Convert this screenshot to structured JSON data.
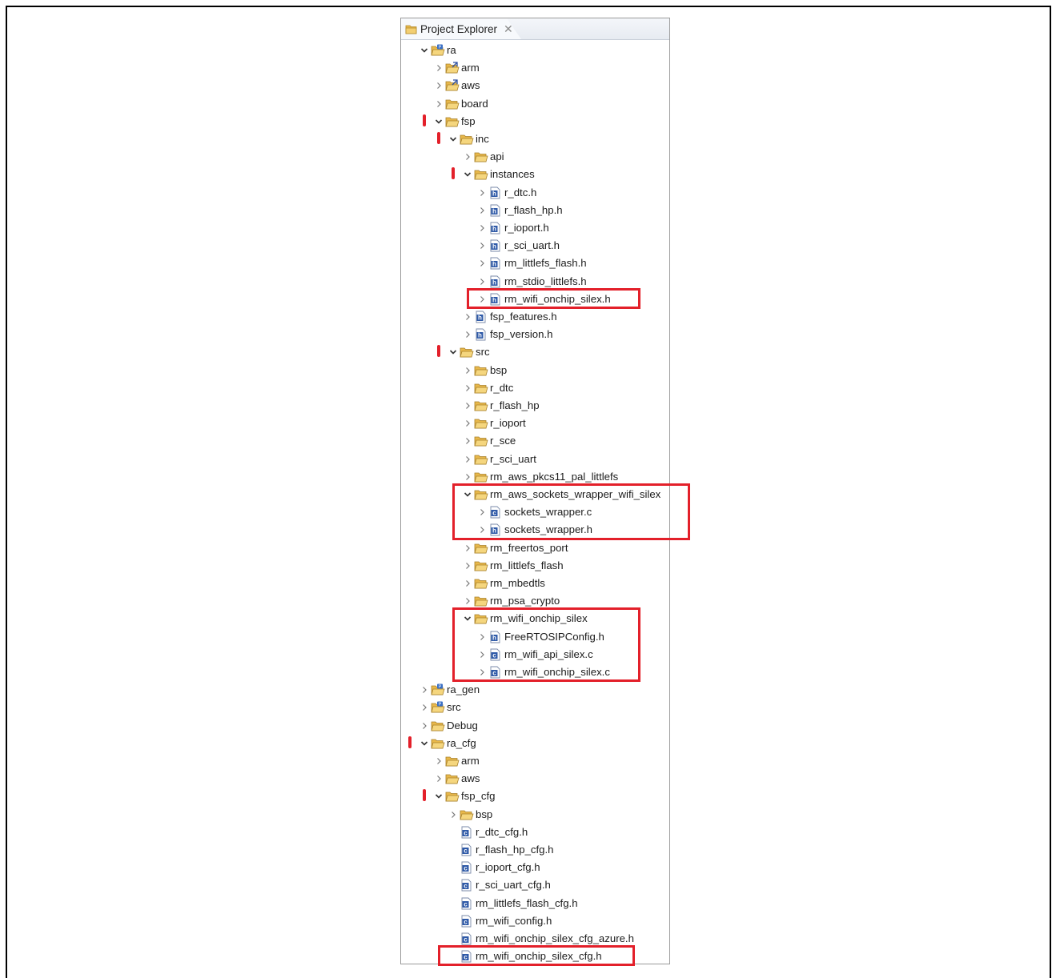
{
  "panel": {
    "tab_label": "Project Explorer",
    "tab_icon": "project-explorer-icon",
    "close_glyph": "✕"
  },
  "tree": [
    {
      "label": "ra",
      "icon": "project-folder-icon",
      "depth": 0,
      "expander": "expanded",
      "marker": false
    },
    {
      "label": "arm",
      "icon": "linked-folder-icon",
      "depth": 1,
      "expander": "collapsed",
      "marker": false
    },
    {
      "label": "aws",
      "icon": "linked-folder-icon",
      "depth": 1,
      "expander": "collapsed",
      "marker": false
    },
    {
      "label": "board",
      "icon": "folder-icon",
      "depth": 1,
      "expander": "collapsed",
      "marker": false
    },
    {
      "label": "fsp",
      "icon": "folder-icon",
      "depth": 1,
      "expander": "expanded",
      "marker": true
    },
    {
      "label": "inc",
      "icon": "folder-icon",
      "depth": 2,
      "expander": "expanded",
      "marker": true
    },
    {
      "label": "api",
      "icon": "folder-icon",
      "depth": 3,
      "expander": "collapsed",
      "marker": false
    },
    {
      "label": "instances",
      "icon": "folder-icon",
      "depth": 3,
      "expander": "expanded",
      "marker": true
    },
    {
      "label": "r_dtc.h",
      "icon": "header-file-icon",
      "depth": 4,
      "expander": "collapsed",
      "marker": false
    },
    {
      "label": "r_flash_hp.h",
      "icon": "header-file-icon",
      "depth": 4,
      "expander": "collapsed",
      "marker": false
    },
    {
      "label": "r_ioport.h",
      "icon": "header-file-icon",
      "depth": 4,
      "expander": "collapsed",
      "marker": false
    },
    {
      "label": "r_sci_uart.h",
      "icon": "header-file-icon",
      "depth": 4,
      "expander": "collapsed",
      "marker": false
    },
    {
      "label": "rm_littlefs_flash.h",
      "icon": "header-file-icon",
      "depth": 4,
      "expander": "collapsed",
      "marker": false
    },
    {
      "label": "rm_stdio_littlefs.h",
      "icon": "header-file-icon",
      "depth": 4,
      "expander": "collapsed",
      "marker": false
    },
    {
      "label": "rm_wifi_onchip_silex.h",
      "icon": "header-file-icon",
      "depth": 4,
      "expander": "collapsed",
      "marker": false
    },
    {
      "label": "fsp_features.h",
      "icon": "header-file-icon",
      "depth": 3,
      "expander": "collapsed",
      "marker": false
    },
    {
      "label": "fsp_version.h",
      "icon": "header-file-icon",
      "depth": 3,
      "expander": "collapsed",
      "marker": false
    },
    {
      "label": "src",
      "icon": "folder-icon",
      "depth": 2,
      "expander": "expanded",
      "marker": true
    },
    {
      "label": "bsp",
      "icon": "folder-icon",
      "depth": 3,
      "expander": "collapsed",
      "marker": false
    },
    {
      "label": "r_dtc",
      "icon": "folder-icon",
      "depth": 3,
      "expander": "collapsed",
      "marker": false
    },
    {
      "label": "r_flash_hp",
      "icon": "folder-icon",
      "depth": 3,
      "expander": "collapsed",
      "marker": false
    },
    {
      "label": "r_ioport",
      "icon": "folder-icon",
      "depth": 3,
      "expander": "collapsed",
      "marker": false
    },
    {
      "label": "r_sce",
      "icon": "folder-icon",
      "depth": 3,
      "expander": "collapsed",
      "marker": false
    },
    {
      "label": "r_sci_uart",
      "icon": "folder-icon",
      "depth": 3,
      "expander": "collapsed",
      "marker": false
    },
    {
      "label": "rm_aws_pkcs11_pal_littlefs",
      "icon": "folder-icon",
      "depth": 3,
      "expander": "collapsed",
      "marker": false
    },
    {
      "label": "rm_aws_sockets_wrapper_wifi_silex",
      "icon": "folder-icon",
      "depth": 3,
      "expander": "expanded",
      "marker": false
    },
    {
      "label": "sockets_wrapper.c",
      "icon": "c-file-icon",
      "depth": 4,
      "expander": "collapsed",
      "marker": false
    },
    {
      "label": "sockets_wrapper.h",
      "icon": "header-file-icon",
      "depth": 4,
      "expander": "collapsed",
      "marker": false
    },
    {
      "label": "rm_freertos_port",
      "icon": "folder-icon",
      "depth": 3,
      "expander": "collapsed",
      "marker": false
    },
    {
      "label": "rm_littlefs_flash",
      "icon": "folder-icon",
      "depth": 3,
      "expander": "collapsed",
      "marker": false
    },
    {
      "label": "rm_mbedtls",
      "icon": "folder-icon",
      "depth": 3,
      "expander": "collapsed",
      "marker": false
    },
    {
      "label": "rm_psa_crypto",
      "icon": "folder-icon",
      "depth": 3,
      "expander": "collapsed",
      "marker": false
    },
    {
      "label": "rm_wifi_onchip_silex",
      "icon": "folder-icon",
      "depth": 3,
      "expander": "expanded",
      "marker": false
    },
    {
      "label": "FreeRTOSIPConfig.h",
      "icon": "header-file-icon",
      "depth": 4,
      "expander": "collapsed",
      "marker": false
    },
    {
      "label": "rm_wifi_api_silex.c",
      "icon": "c-file-icon",
      "depth": 4,
      "expander": "collapsed",
      "marker": false
    },
    {
      "label": "rm_wifi_onchip_silex.c",
      "icon": "c-file-icon",
      "depth": 4,
      "expander": "collapsed",
      "marker": false
    },
    {
      "label": "ra_gen",
      "icon": "project-folder-icon",
      "depth": 0,
      "expander": "collapsed",
      "marker": false
    },
    {
      "label": "src",
      "icon": "project-folder-icon",
      "depth": 0,
      "expander": "collapsed",
      "marker": false
    },
    {
      "label": "Debug",
      "icon": "folder-icon",
      "depth": 0,
      "expander": "collapsed",
      "marker": false
    },
    {
      "label": "ra_cfg",
      "icon": "folder-icon",
      "depth": 0,
      "expander": "expanded",
      "marker": true
    },
    {
      "label": "arm",
      "icon": "folder-icon",
      "depth": 1,
      "expander": "collapsed",
      "marker": false
    },
    {
      "label": "aws",
      "icon": "folder-icon",
      "depth": 1,
      "expander": "collapsed",
      "marker": false
    },
    {
      "label": "fsp_cfg",
      "icon": "folder-icon",
      "depth": 1,
      "expander": "expanded",
      "marker": true
    },
    {
      "label": "bsp",
      "icon": "folder-icon",
      "depth": 2,
      "expander": "collapsed",
      "marker": false
    },
    {
      "label": "r_dtc_cfg.h",
      "icon": "c-file-icon",
      "depth": 2,
      "expander": "none",
      "marker": false
    },
    {
      "label": "r_flash_hp_cfg.h",
      "icon": "c-file-icon",
      "depth": 2,
      "expander": "none",
      "marker": false
    },
    {
      "label": "r_ioport_cfg.h",
      "icon": "c-file-icon",
      "depth": 2,
      "expander": "none",
      "marker": false
    },
    {
      "label": "r_sci_uart_cfg.h",
      "icon": "c-file-icon",
      "depth": 2,
      "expander": "none",
      "marker": false
    },
    {
      "label": "rm_littlefs_flash_cfg.h",
      "icon": "c-file-icon",
      "depth": 2,
      "expander": "none",
      "marker": false
    },
    {
      "label": "rm_wifi_config.h",
      "icon": "c-file-icon",
      "depth": 2,
      "expander": "none",
      "marker": false
    },
    {
      "label": "rm_wifi_onchip_silex_cfg_azure.h",
      "icon": "c-file-icon",
      "depth": 2,
      "expander": "none",
      "marker": false
    },
    {
      "label": "rm_wifi_onchip_silex_cfg.h",
      "icon": "c-file-icon",
      "depth": 2,
      "expander": "none",
      "marker": false
    }
  ],
  "highlight_groups": [
    {
      "name": "highlight-rm-wifi-onchip-silex-h",
      "first": 14,
      "last": 14
    },
    {
      "name": "highlight-sockets-wrapper-group",
      "first": 25,
      "last": 27
    },
    {
      "name": "highlight-rm-wifi-onchip-silex-group",
      "first": 32,
      "last": 35
    },
    {
      "name": "highlight-rm-wifi-onchip-silex-cfg-h",
      "first": 51,
      "last": 51
    }
  ],
  "colors": {
    "highlight": "#e3202a",
    "folder": "#e8b84b",
    "project_badge": "#3a6fc4",
    "file_badge": "#2f5aa8"
  }
}
